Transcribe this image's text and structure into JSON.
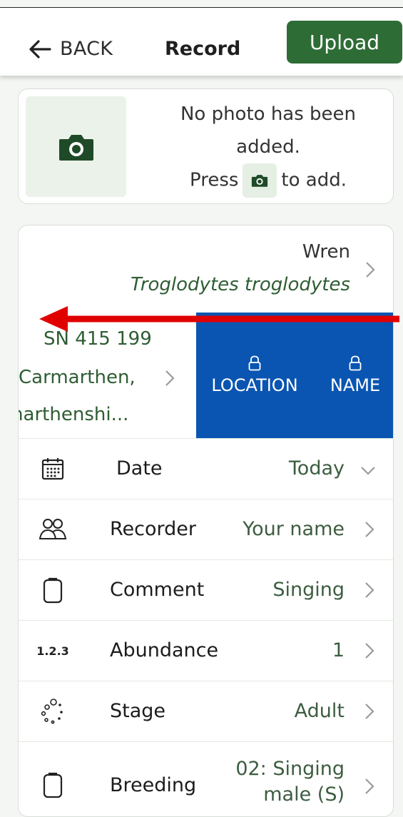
{
  "header": {
    "back_label": "BACK",
    "title": "Record",
    "upload_label": "Upload"
  },
  "photo": {
    "message_line1": "No photo has been added.",
    "press": "Press",
    "to_add": "to add."
  },
  "species": {
    "common_name": "Wren",
    "latin_name": "Troglodytes troglodytes"
  },
  "location": {
    "grid_ref": "SN 415 199",
    "name": "Carmarthen,",
    "county": "rmarthenshi..."
  },
  "locks": {
    "location_label": "LOCATION",
    "name_label": "NAME"
  },
  "rows": [
    {
      "label": "Date",
      "value": "Today"
    },
    {
      "label": "Recorder",
      "value": "Your name"
    },
    {
      "label": "Comment",
      "value": "Singing"
    },
    {
      "label": "Abundance",
      "value": "1"
    },
    {
      "label": "Stage",
      "value": "Adult"
    },
    {
      "label": "Breeding",
      "value_line1": "02: Singing",
      "value_line2": "male (S)"
    }
  ],
  "icons": {
    "abundance_text": "1.2.3"
  },
  "colors": {
    "primary_green": "#2e6c36",
    "swipe_blue": "#0a55b1",
    "arrow_red": "#e10000"
  }
}
